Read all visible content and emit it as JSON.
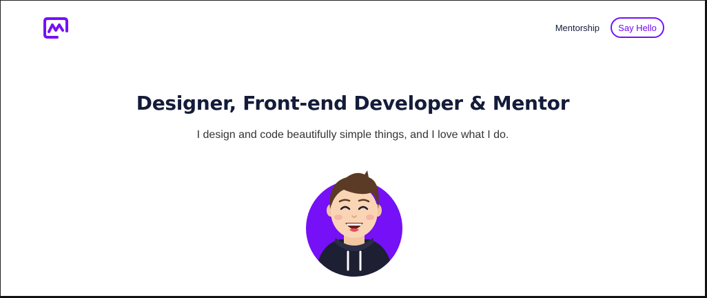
{
  "header": {
    "logo_icon": "m-monogram-logo",
    "nav": {
      "mentorship_label": "Mentorship",
      "say_hello_label": "Say Hello"
    }
  },
  "hero": {
    "title": "Designer, Front-end Developer & Mentor",
    "subtitle": "I design and code beautifully simple things, and I love what I do.",
    "avatar_icon": "smiling-person-avatar"
  },
  "colors": {
    "accent": "#7510f7",
    "heading": "#141c3a",
    "body_text": "#333333",
    "background": "#ffffff",
    "avatar_circle": "#7510f7",
    "hoodie": "#1d1f33"
  }
}
